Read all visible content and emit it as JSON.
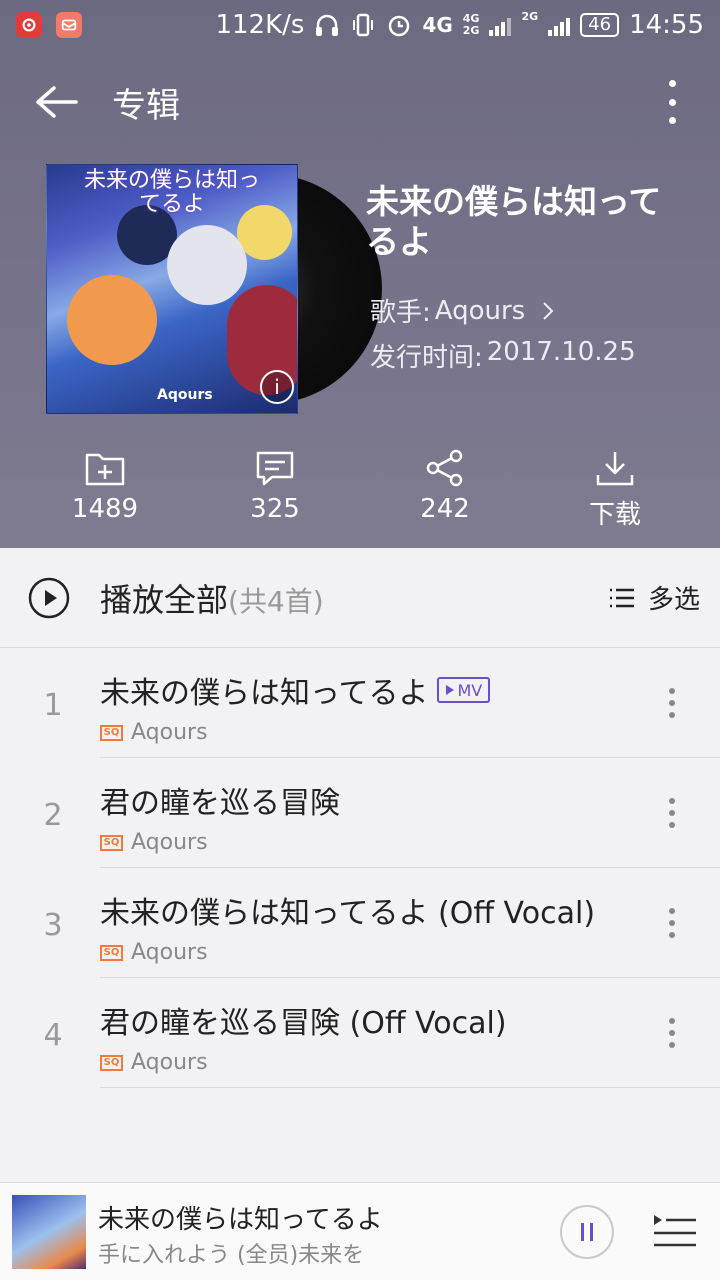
{
  "status": {
    "speed": "112K/s",
    "net1": "4G",
    "net2": "4G",
    "net3": "2G",
    "net4": "2G",
    "battery": "46",
    "time": "14:55"
  },
  "header": {
    "title": "专辑"
  },
  "album": {
    "cover_title": "未来の僕らは知ってるよ",
    "cover_logo": "Aqours",
    "name": "未来の僕らは知ってるよ",
    "artist_label": "歌手:",
    "artist": "Aqours",
    "release_label": "发行时间:",
    "release_date": "2017.10.25"
  },
  "actions": [
    {
      "icon": "folder-add-icon",
      "label": "1489"
    },
    {
      "icon": "comment-icon",
      "label": "325"
    },
    {
      "icon": "share-icon",
      "label": "242"
    },
    {
      "icon": "download-icon",
      "label": "下载"
    }
  ],
  "playall": {
    "label": "播放全部",
    "count": "(共4首)",
    "multi_label": "多选"
  },
  "tracks": [
    {
      "index": "1",
      "title": "未来の僕らは知ってるよ",
      "mv": "MV",
      "quality": "SQ",
      "artist": "Aqours"
    },
    {
      "index": "2",
      "title": "君の瞳を巡る冒険",
      "quality": "SQ",
      "artist": "Aqours"
    },
    {
      "index": "3",
      "title": "未来の僕らは知ってるよ (Off Vocal)",
      "quality": "SQ",
      "artist": "Aqours"
    },
    {
      "index": "4",
      "title": "君の瞳を巡る冒険 (Off Vocal)",
      "quality": "SQ",
      "artist": "Aqours"
    }
  ],
  "player": {
    "title": "未来の僕らは知ってるよ",
    "lyric": "手に入れよう (全员)未来を"
  },
  "colors": {
    "accent": "#6b4ecb",
    "header_bg": "#76738a",
    "sq_badge": "#f17a3c"
  }
}
